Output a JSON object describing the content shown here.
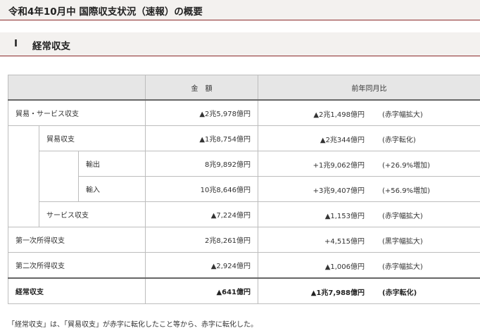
{
  "page_title": "令和4年10月中 国際収支状況（速報）の概要",
  "section": {
    "number": "Ⅰ",
    "title": "経常収支"
  },
  "table": {
    "headers": {
      "label": "",
      "amount": "金　額",
      "yoy": "前年同月比"
    },
    "rows": {
      "trade_services": {
        "label": "貿易・サービス収支",
        "amount": "▲2兆5,978億円",
        "yoy": "▲2兆1,498億円",
        "note": "(赤字幅拡大)"
      },
      "trade": {
        "label": "貿易収支",
        "amount": "▲1兆8,754億円",
        "yoy": "▲2兆344億円",
        "note": "(赤字転化)"
      },
      "exports": {
        "label": "輸出",
        "amount": "8兆9,892億円",
        "yoy": "+1兆9,062億円",
        "note": "(+26.9%増加)"
      },
      "imports": {
        "label": "輸入",
        "amount": "10兆8,646億円",
        "yoy": "+3兆9,407億円",
        "note": "(+56.9%増加)"
      },
      "services": {
        "label": "サービス収支",
        "amount": "▲7,224億円",
        "yoy": "▲1,153億円",
        "note": "(赤字幅拡大)"
      },
      "primary_income": {
        "label": "第一次所得収支",
        "amount": "2兆8,261億円",
        "yoy": "+4,515億円",
        "note": "(黒字幅拡大)"
      },
      "secondary_income": {
        "label": "第二次所得収支",
        "amount": "▲2,924億円",
        "yoy": "▲1,006億円",
        "note": "(赤字幅拡大)"
      },
      "current_account": {
        "label": "経常収支",
        "amount": "▲641億円",
        "yoy": "▲1兆7,988億円",
        "note": "(赤字転化)"
      }
    }
  },
  "footnote": "「経常収支」は、「貿易収支」が赤字に転化したこと等から、赤字に転化した。",
  "colors": {
    "accent_rule": "#8b2a2a",
    "band_bg": "#f3f1ef",
    "header_bg": "#e6e6e6",
    "grid": "#bdbdbd"
  }
}
